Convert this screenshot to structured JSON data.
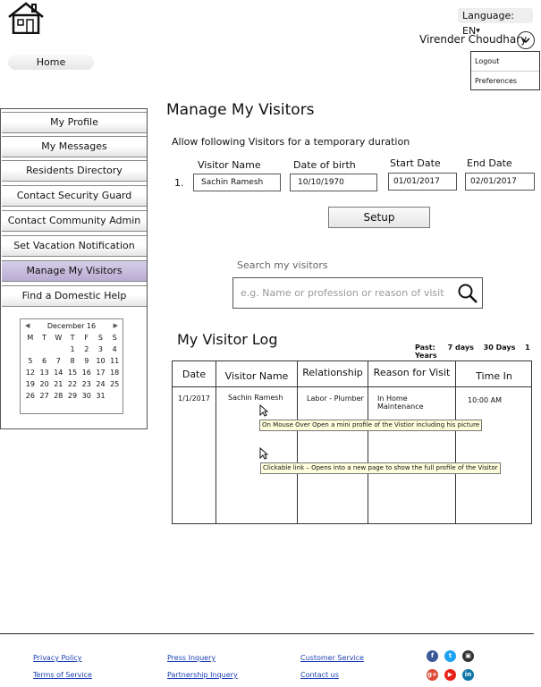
{
  "header": {
    "language_label": "Language: EN",
    "user_name": "Virender Choudhary",
    "user_menu": [
      "Logout",
      "Preferences"
    ],
    "home_label": "Home"
  },
  "sidebar": {
    "items": [
      {
        "label": "My Profile"
      },
      {
        "label": "My Messages"
      },
      {
        "label": "Residents Directory"
      },
      {
        "label": "Contact Security Guard"
      },
      {
        "label": "Contact Community Admin"
      },
      {
        "label": "Set Vacation Notification"
      },
      {
        "label": "Manage My Visitors",
        "active": true
      },
      {
        "label": "Find a Domestic Help"
      }
    ],
    "calendar": {
      "month_label": "December 16",
      "weekdays": [
        "M",
        "T",
        "W",
        "T",
        "F",
        "S",
        "S"
      ],
      "weeks": [
        [
          "",
          "",
          "",
          "1",
          "2",
          "3",
          "4"
        ],
        [
          "5",
          "6",
          "7",
          "8",
          "9",
          "10",
          "11"
        ],
        [
          "12",
          "13",
          "14",
          "15",
          "16",
          "17",
          "18"
        ],
        [
          "19",
          "20",
          "21",
          "22",
          "23",
          "24",
          "25"
        ],
        [
          "26",
          "27",
          "28",
          "29",
          "30",
          "31",
          ""
        ]
      ]
    }
  },
  "main": {
    "title": "Manage My Visitors",
    "subtitle": "Allow following Visitors for a temporary  duration",
    "form": {
      "visitor_name_label": "Visitor Name",
      "dob_label": "Date of birth",
      "start_date_label": "Start Date",
      "end_date_label": "End Date",
      "row_number": "1.",
      "visitor_name_value": "Sachin Ramesh",
      "dob_value": "10/10/1970",
      "start_date_value": "01/01/2017",
      "end_date_value": "02/01/2017",
      "setup_label": "Setup"
    },
    "search": {
      "label": "Search  my visitors",
      "placeholder": "e.g. Name or profession or reason of visit"
    },
    "log": {
      "title": "My Visitor Log",
      "past_label": "Past:",
      "past_options": [
        "7 days",
        "30 Days",
        "1 Years"
      ],
      "columns": [
        "Date",
        "Visitor Name",
        "Relationship",
        "Reason for Visit",
        "Time In"
      ],
      "rows": [
        {
          "date": "1/1/2017",
          "visitor_name": "Sachin Ramesh",
          "relationship": "Labor - Plumber",
          "reason": "In Home Maintenance",
          "time_in": "10:00 AM"
        }
      ],
      "tooltip_hover": "On Mouse Over Open a mini profile of the Vistior including his picture",
      "tooltip_click": "Clickable link – Opens into a new page to show the full profile of the Visitor"
    }
  },
  "footer": {
    "links": [
      "Privacy Policy",
      "Terms of Service",
      "Press Inquery",
      "Partnership Inquery",
      "Customer Service",
      "Contact us"
    ],
    "social": [
      {
        "icon": "facebook-icon",
        "glyph": "f",
        "color": "#3b5998"
      },
      {
        "icon": "twitter-icon",
        "glyph": "t",
        "color": "#1da1f2"
      },
      {
        "icon": "instagram-icon",
        "glyph": "▣",
        "color": "#333333"
      },
      {
        "icon": "google-plus-icon",
        "glyph": "g+",
        "color": "#dd4b39"
      },
      {
        "icon": "youtube-icon",
        "glyph": "▶",
        "color": "#e62117"
      },
      {
        "icon": "linkedin-icon",
        "glyph": "in",
        "color": "#0e76a8"
      }
    ]
  }
}
